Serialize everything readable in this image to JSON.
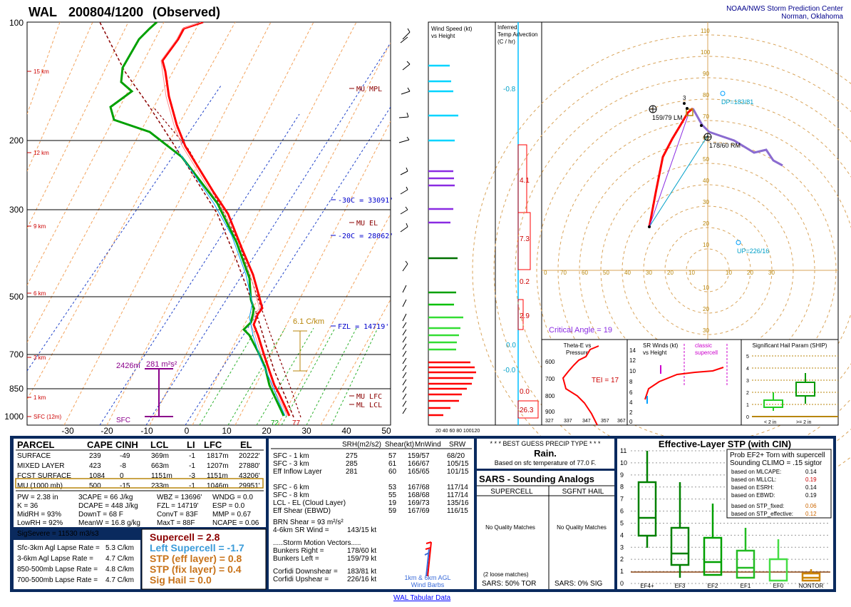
{
  "header": {
    "station": "WAL",
    "datetime": "200804/1200",
    "mode": "(Observed)",
    "org_line1": "NOAA/NWS Storm Prediction Center",
    "org_line2": "Norman, Oklahoma"
  },
  "skewt": {
    "pressure_labels": [
      "100",
      "200",
      "300",
      "500",
      "700",
      "850",
      "1000"
    ],
    "height_labels": [
      "15 km",
      "12 km",
      "9 km",
      "6 km",
      "3 km",
      "1 km",
      "SFC (12m)"
    ],
    "temp_ticks": [
      "-30",
      "-20",
      "-10",
      "0",
      "10",
      "20",
      "30",
      "40",
      "50"
    ],
    "annotations": {
      "mu_mpl": "MU MPL",
      "mu_el": "MU EL",
      "mu_lfc": "MU LFC",
      "ml_lcl": "ML LCL",
      "m30c": "-30C = 33091'",
      "m20c": "-20C = 28062'",
      "fzl": "FZL = 14719'",
      "lapse": "6.1 C/km",
      "srh": "281 m²s²",
      "srh_left": "2426m",
      "sfc": "SFC",
      "temp_sfc": "77",
      "dew_sfc": "72"
    }
  },
  "wind_panel": {
    "title1": "Wind Speed (kt)",
    "title2": "vs Height",
    "axis": "20 40 60 80 100120"
  },
  "tadv_panel": {
    "title1": "Inferred",
    "title2": "Temp Advection",
    "title3": "(C / hr)",
    "values": [
      "-0.8",
      "4.1",
      "7.3",
      "0.2",
      "2.9",
      "0.0",
      "-0.0",
      "0.0",
      "26.3"
    ]
  },
  "hodo": {
    "rings_top": [
      "110",
      "100",
      "90",
      "80",
      "70",
      "60",
      "50",
      "40",
      "30",
      "20",
      "10"
    ],
    "rings_bot": [
      "10",
      "20",
      "30"
    ],
    "x_left": [
      "0",
      "70",
      "60",
      "50",
      "40",
      "30",
      "20",
      "10"
    ],
    "x_right": [
      "10",
      "20",
      "30"
    ],
    "x_label_zero": "0",
    "lm": "159/79 LM",
    "rm": "178/60 RM",
    "dp": "DP=183/81",
    "up": "UP=226/16",
    "critical": "Critical Angle = 19",
    "label_3": "3"
  },
  "theta_panel": {
    "title1": "Theta-E vs",
    "title2": "Pressure",
    "tei": "TEI = 17",
    "y": [
      "600",
      "700",
      "800",
      "900"
    ],
    "x": [
      "327",
      "337",
      "347",
      "357",
      "367"
    ]
  },
  "srwind_panel": {
    "title1": "SR Winds (kt)",
    "title2": "vs Height",
    "classic1": "classic",
    "classic2": "supercell",
    "y": [
      "14",
      "12",
      "10",
      "8",
      "6",
      "4",
      "2",
      "0"
    ]
  },
  "ship_panel": {
    "title": "Significant Hail Param (SHIP)",
    "y": [
      "5",
      "4",
      "3",
      "2",
      "1",
      "0"
    ],
    "lt2": "< 2 in",
    "ge2": ">= 2 in"
  },
  "parcel_table": {
    "headers": [
      "PARCEL",
      "CAPE",
      "CINH",
      "LCL",
      "LI",
      "LFC",
      "EL"
    ],
    "rows": [
      [
        "SURFACE",
        "239",
        "-49",
        "369m",
        "-1",
        "1817m",
        "20222'"
      ],
      [
        "MIXED LAYER",
        "423",
        "-8",
        "663m",
        "-1",
        "1207m",
        "27880'"
      ],
      [
        "FCST SURFACE",
        "1084",
        "0",
        "1151m",
        "-3",
        "1151m",
        "43206'"
      ],
      [
        "MU  (1000 mb)",
        "500",
        "-15",
        "233m",
        "-1",
        "1046m",
        "29951'"
      ]
    ]
  },
  "thermo_params": [
    [
      "PW = 2.38 in",
      "3CAPE = 66 J/kg",
      "WBZ = 13696'",
      "WNDG = 0.0"
    ],
    [
      "K = 36",
      "DCAPE = 448 J/kg",
      "FZL = 14719'",
      "ESP = 0.0"
    ],
    [
      "MidRH = 93%",
      "DownT = 68 F",
      "ConvT = 83F",
      "MMP = 0.67"
    ],
    [
      "LowRH = 92%",
      "MeanW = 16.8 g/kg",
      "MaxT = 88F",
      "NCAPE = 0.06"
    ]
  ],
  "sig_severe": "SigSevere = 11530 m3/s3",
  "lapse_rates": [
    [
      "Sfc-3km Agl Lapse Rate =",
      "5.3 C/km"
    ],
    [
      "3-6km Agl Lapse Rate =",
      "4.7 C/km"
    ],
    [
      "850-500mb Lapse Rate =",
      "4.8 C/km"
    ],
    [
      "700-500mb Lapse Rate =",
      "4.7 C/km"
    ]
  ],
  "composites": [
    {
      "text": "Supercell = 2.8",
      "color": "#8b0000"
    },
    {
      "text": "Left Supercell = -1.7",
      "color": "#3a9bd9"
    },
    {
      "text": "STP (eff layer) = 0.8",
      "color": "#c8731a"
    },
    {
      "text": "STP (fix layer) = 0.4",
      "color": "#c8731a"
    },
    {
      "text": "Sig Hail = 0.0",
      "color": "#c8731a"
    }
  ],
  "kinematic": {
    "headers": [
      "SRH(m2/s2)",
      "Shear(kt)",
      "MnWind",
      "SRW"
    ],
    "rows": [
      [
        "SFC - 1 km",
        "275",
        "57",
        "159/57",
        "68/20"
      ],
      [
        "SFC - 3 km",
        "285",
        "61",
        "166/67",
        "105/15"
      ],
      [
        "Eff Inflow Layer",
        "281",
        "60",
        "165/65",
        "101/15"
      ],
      [
        "",
        "",
        " ",
        "",
        ""
      ],
      [
        "SFC - 6 km",
        "",
        "53",
        "167/68",
        "117/14"
      ],
      [
        "SFC - 8 km",
        "",
        "55",
        "168/68",
        "117/14"
      ],
      [
        "LCL - EL (Cloud Layer)",
        "",
        "19",
        "169/73",
        "135/16"
      ],
      [
        "Eff Shear (EBWD)",
        "",
        "59",
        "167/69",
        "116/15"
      ]
    ],
    "brn": "BRN Shear = 93 m²/s²",
    "srwind": "4-6km SR Wind =",
    "srwind_val": "143/15 kt",
    "storm_motion": ".....Storm Motion Vectors.....",
    "bunkers_right": "Bunkers Right =",
    "bunkers_right_val": "178/60 kt",
    "bunkers_left": "Bunkers Left =",
    "bunkers_left_val": "159/79 kt",
    "corfidi_down": "Corfidi Downshear =",
    "corfidi_down_val": "183/81 kt",
    "corfidi_up": "Corfidi Upshear =",
    "corfidi_up_val": "226/16 kt",
    "barb_label1": "1km & 6km AGL",
    "barb_label2": "Wind Barbs"
  },
  "precip": {
    "title": "* * * BEST GUESS PRECIP TYPE * * *",
    "value": "Rain.",
    "note": "Based on sfc temperature of 77.0 F."
  },
  "sars": {
    "title": "SARS - Sounding Analogs",
    "supercell": "SUPERCELL",
    "sgfnt": "SGFNT HAIL",
    "no_match": "No Quality Matches",
    "loose": "(2 loose matches)",
    "tor": "SARS:  50% TOR",
    "sig": "SARS:  0% SIG"
  },
  "stp_panel": {
    "title": "Effective-Layer STP (with CIN)",
    "prob": "Prob EF2+ Torn with supercell",
    "climo": "Sounding CLIMO = .15 sigtor",
    "rows": [
      [
        "based on MLCAPE:",
        "0.14"
      ],
      [
        "based on MLLCL:",
        "0.19"
      ],
      [
        "based on ESRH:",
        "0.14"
      ],
      [
        "based on EBWD:",
        "0.19"
      ],
      [
        "based on STP_fixed:",
        "0.06"
      ],
      [
        "based on STP_effective:",
        "0.12"
      ]
    ],
    "y": [
      "11",
      "10",
      "9",
      "8",
      "7",
      "6",
      "5",
      "4",
      "3",
      "2",
      "1",
      "0"
    ],
    "x": [
      "EF4+",
      "EF3",
      "EF2",
      "EF1",
      "EF0",
      "NONTOR"
    ]
  },
  "footer": "WAL Tabular Data",
  "colors": {
    "temp": "#ff0000",
    "dew": "#00a000",
    "frame": "#0a2a5e",
    "hodo": "#ff0000"
  }
}
